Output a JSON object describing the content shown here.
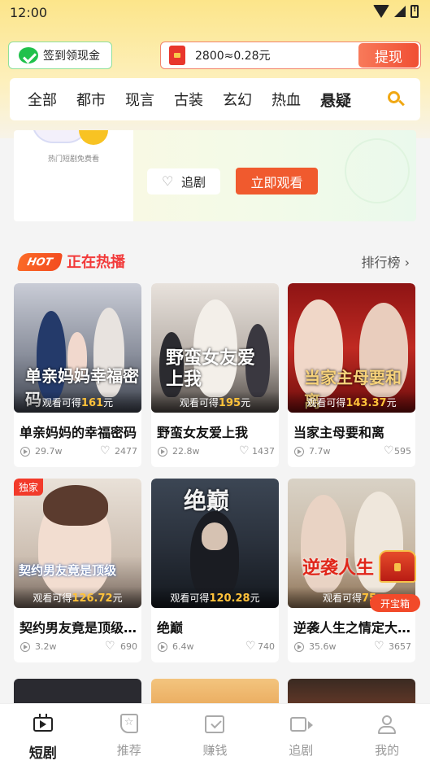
{
  "status": {
    "time": "12:00"
  },
  "header": {
    "signin_label": "签到领现金",
    "cash_amount": "2800≈0.28元",
    "withdraw_label": "提现"
  },
  "tabs": [
    "全部",
    "都市",
    "现言",
    "古装",
    "玄幻",
    "热血",
    "悬疑"
  ],
  "active_tab": "悬疑",
  "banner": {
    "caption": "热门短剧免费看",
    "follow_label": "追剧",
    "watch_label": "立即观看"
  },
  "section": {
    "hot_badge": "HOT",
    "title": "正在热播",
    "rank_label": "排行榜"
  },
  "earn_prefix": "观看可得",
  "earn_suffix": "元",
  "cards": [
    {
      "title": "单亲妈妈的幸福密码",
      "poster_text": "单亲妈妈幸福密码",
      "earn": "161",
      "views": "29.7w",
      "likes": "2477",
      "tag": ""
    },
    {
      "title": "野蛮女友爱上我",
      "poster_text": "野蛮女友爱上我",
      "earn": "195",
      "views": "22.8w",
      "likes": "1437",
      "tag": ""
    },
    {
      "title": "当家主母要和离",
      "poster_text": "当家主母要和离",
      "earn": "143.37",
      "views": "7.7w",
      "likes": "595",
      "tag": ""
    },
    {
      "title": "契约男友竟是顶级…",
      "poster_text": "契约男友竟是顶级",
      "earn": "126.72",
      "views": "3.2w",
      "likes": "690",
      "tag": "独家"
    },
    {
      "title": "绝巅",
      "poster_text": "绝巅",
      "earn": "120.28",
      "views": "6.4w",
      "likes": "740",
      "tag": ""
    },
    {
      "title": "逆袭人生之情定大…",
      "poster_text": "逆袭人生",
      "earn": "75.",
      "views": "35.6w",
      "likes": "3657",
      "tag": ""
    }
  ],
  "treasure_label": "开宝箱",
  "nav": [
    {
      "label": "短剧",
      "icon": "tv-icon"
    },
    {
      "label": "推荐",
      "icon": "star-bookmark-icon"
    },
    {
      "label": "赚钱",
      "icon": "checkbox-icon"
    },
    {
      "label": "追剧",
      "icon": "video-camera-icon"
    },
    {
      "label": "我的",
      "icon": "person-icon"
    }
  ],
  "colors": {
    "accent": "#f05a2e",
    "brand_yellow": "#fce58a",
    "hot_red": "#f23a3a",
    "earn_gold": "#ffc23a"
  }
}
